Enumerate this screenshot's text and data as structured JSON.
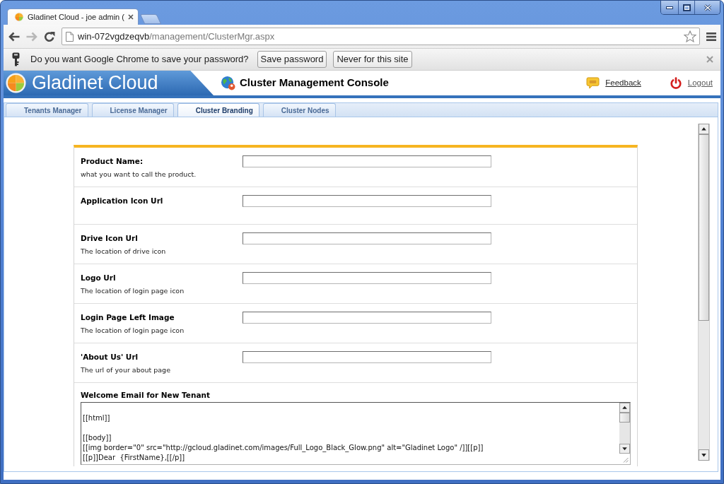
{
  "browser": {
    "tabs": [
      {
        "title": "Gladinet Cloud - joe admin (",
        "selected": true
      }
    ],
    "nav_buttons": [
      {
        "kind": "back",
        "disabled": false
      },
      {
        "kind": "forward",
        "disabled": true
      },
      {
        "kind": "reload",
        "disabled": false
      }
    ],
    "address_bar": {
      "host": "win-072vgdzeqvb",
      "path": "/management/ClusterMgr.aspx"
    },
    "infobar": {
      "message": "Do you want Google Chrome to save your password?",
      "buttons": [
        "Save password",
        "Never for this site"
      ]
    }
  },
  "page": {
    "header": {
      "logo_text": "Gladinet Cloud",
      "title": "Cluster Management Console",
      "links": [
        {
          "kind": "feedback",
          "label": "Feedback"
        },
        {
          "kind": "logout",
          "label": "Logout"
        }
      ]
    },
    "tabs": [
      {
        "label": "Tenants Manager",
        "selected": false
      },
      {
        "label": "License Manager",
        "selected": false
      },
      {
        "label": "Cluster Branding",
        "selected": true
      },
      {
        "label": "Cluster Nodes",
        "selected": false
      }
    ],
    "form": {
      "fields": [
        {
          "kind": "input",
          "label": "Product Name:",
          "description": "what you want to call the product."
        },
        {
          "kind": "input",
          "label": "Application Icon Url"
        },
        {
          "kind": "input",
          "label": "Drive Icon Url",
          "description": "The location of drive icon"
        },
        {
          "kind": "input",
          "label": "Logo Url",
          "description": "The location of login page icon"
        },
        {
          "kind": "input",
          "label": "Login Page Left Image",
          "description": "The location of login page icon"
        },
        {
          "kind": "input",
          "label": "'About Us' Url",
          "description": "The url of your about page"
        },
        {
          "kind": "textarea",
          "label": "Welcome Email for New Tenant",
          "value": "\n[[html]]\n\n[[body]]\n[[img border=\"0\" src=\"http://gcloud.gladinet.com/images/Full_Logo_Black_Glow.png\" alt=\"Gladinet Logo\" /]][[p]]\n[[p]]Dear  {FirstName},[[/p]]"
        }
      ]
    }
  }
}
